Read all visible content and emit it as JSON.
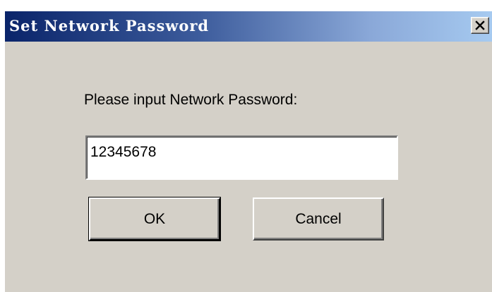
{
  "window": {
    "title": "Set Network Password"
  },
  "dialog": {
    "prompt": "Please input Network Password:",
    "password_value": "12345678",
    "ok_label": "OK",
    "cancel_label": "Cancel"
  },
  "icons": {
    "close": "close-icon"
  },
  "colors": {
    "face": "#d4d0c8",
    "title_start": "#0a246a",
    "title_end": "#a6caf0",
    "title_text": "#ffffff"
  }
}
